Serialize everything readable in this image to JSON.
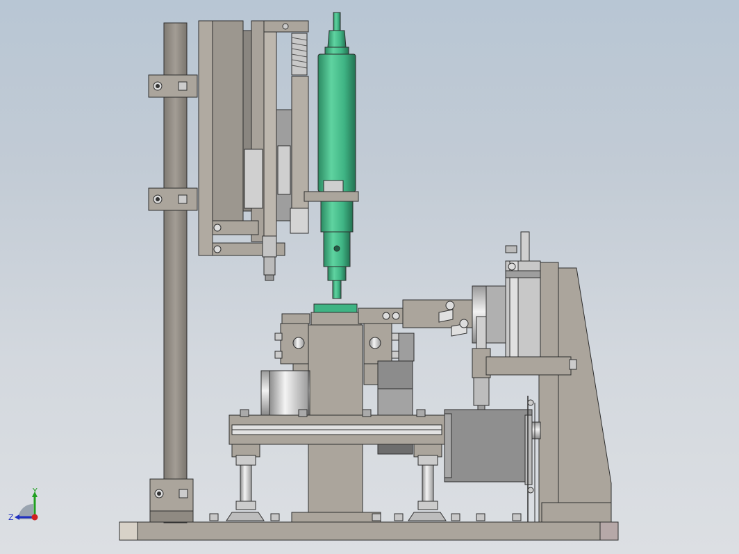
{
  "viewport": {
    "background_top": "#b8c6d4",
    "background_bottom": "#dcdfe3"
  },
  "colors": {
    "frame_grey": "#aba59c",
    "frame_dark": "#8f8a82",
    "frame_edge": "#2e2e2e",
    "spindle_green": "#3fb484",
    "spindle_green_dark": "#2b8a62",
    "metal_light": "#e6e6e6",
    "metal_mid": "#b7b7b7",
    "motor_grey": "#9a9a9a"
  },
  "triad": {
    "x_label": "",
    "y_label": "Y",
    "z_label": "Z",
    "y_color": "#20a020",
    "z_color": "#2030c0",
    "x_color": "#d02020"
  }
}
